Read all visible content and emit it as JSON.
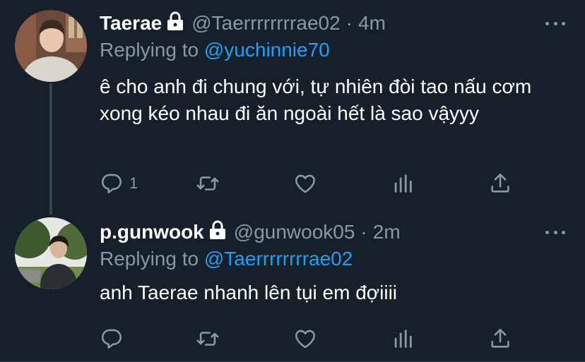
{
  "colors": {
    "background": "#15202b",
    "text": "#ffffff",
    "muted": "#8899a6",
    "link": "#1da1f2"
  },
  "tweets": [
    {
      "name": "Taerae",
      "handle": "@Taerrrrrrrrae02",
      "time": "4m",
      "replying_label": "Replying to",
      "replying_to": "@yuchinnie70",
      "text": "ê cho anh đi chung với, tự nhiên đòi tao nấu cơm xong kéo nhau đi ăn ngoài hết là sao vậyyy",
      "reply_count": "1",
      "icons": [
        "reply-icon",
        "retweet-icon",
        "like-icon",
        "analytics-icon",
        "share-icon"
      ]
    },
    {
      "name": "p.gunwook",
      "handle": "@gunwook05",
      "time": "2m",
      "replying_label": "Replying to",
      "replying_to": "@Taerrrrrrrrae02",
      "text": "anh Taerae nhanh lên tụi em đợiiii",
      "reply_count": "",
      "icons": [
        "reply-icon",
        "retweet-icon",
        "like-icon",
        "analytics-icon",
        "share-icon"
      ]
    }
  ],
  "separator": "·"
}
